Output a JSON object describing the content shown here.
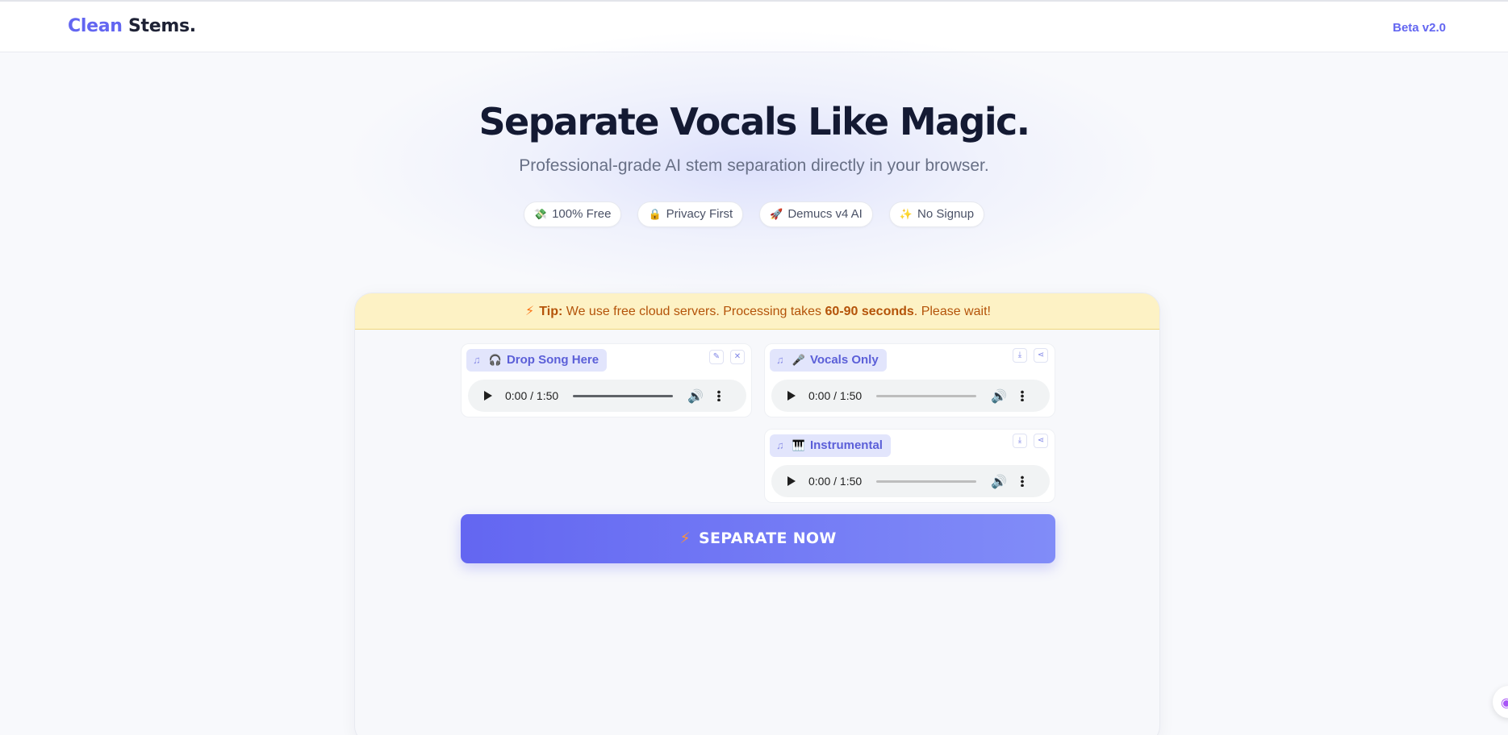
{
  "header": {
    "logo_part1": "Clean",
    "logo_part2": "Stems.",
    "version": "Beta v2.0"
  },
  "hero": {
    "title": "Separate Vocals Like Magic.",
    "subtitle": "Professional-grade AI stem separation directly in your browser.",
    "badges": [
      {
        "emoji": "💸",
        "label": "100% Free"
      },
      {
        "emoji": "🔒",
        "label": "Privacy First"
      },
      {
        "emoji": "🚀",
        "label": "Demucs v4 AI"
      },
      {
        "emoji": "✨",
        "label": "No Signup"
      }
    ]
  },
  "tip": {
    "icon": "⚡",
    "lead": "Tip:",
    "text_before": "We use free cloud servers. Processing takes",
    "highlight": "60-90 seconds",
    "text_after": ". Please wait!"
  },
  "players": {
    "input": {
      "label": "Drop Song Here",
      "emoji": "🎧",
      "time": "0:00 / 1:50"
    },
    "vocals": {
      "label": "Vocals Only",
      "emoji": "🎤",
      "time": "0:00 / 1:50"
    },
    "instrumental": {
      "label": "Instrumental",
      "emoji": "🎹",
      "time": "0:00 / 1:50"
    }
  },
  "action": {
    "icon": "⚡",
    "label": "SEPARATE NOW"
  },
  "icons": {
    "music_note": "music-note-icon",
    "edit": "pencil-icon",
    "close": "close-icon",
    "download": "download-icon",
    "share": "share-icon",
    "play": "play-icon",
    "volume": "volume-icon",
    "more": "more-vertical-icon"
  },
  "colors": {
    "accent": "#6366f1",
    "tip_background": "#fdf2c5",
    "tip_text": "#b45309"
  }
}
